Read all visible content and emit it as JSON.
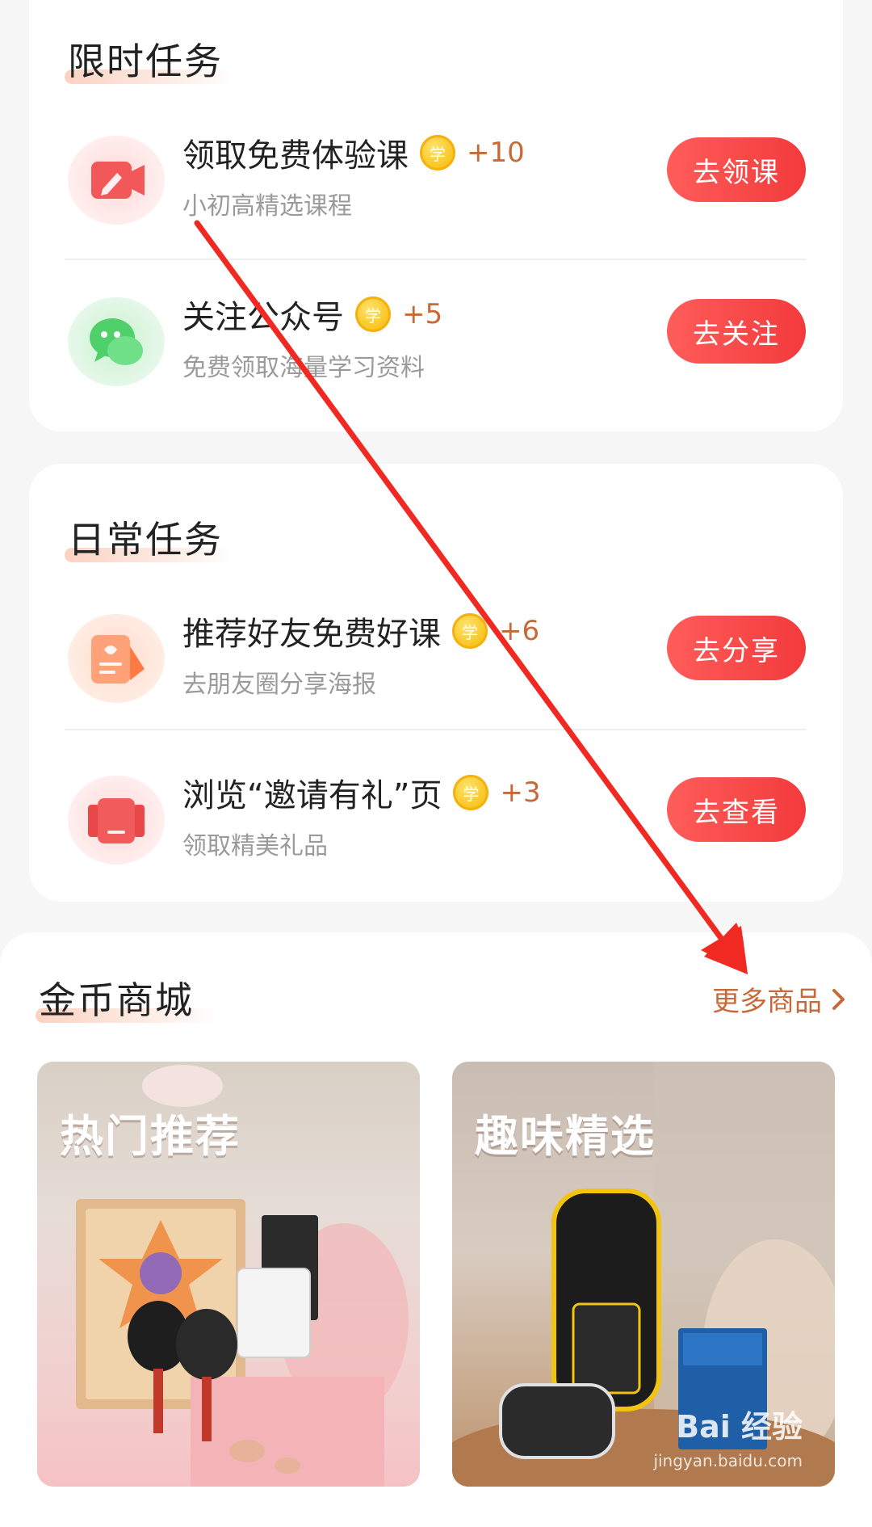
{
  "limited_tasks": {
    "title": "限时任务",
    "items": [
      {
        "title": "领取免费体验课",
        "reward": "+10",
        "subtitle": "小初高精选课程",
        "button": "去领课",
        "icon": "pencil-video-icon"
      },
      {
        "title": "关注公众号",
        "reward": "+5",
        "subtitle": "免费领取海量学习资料",
        "button": "去关注",
        "icon": "wechat-icon"
      }
    ]
  },
  "daily_tasks": {
    "title": "日常任务",
    "items": [
      {
        "title": "推荐好友免费好课",
        "reward": "+6",
        "subtitle": "去朋友圈分享海报",
        "button": "去分享",
        "icon": "share-poster-icon"
      },
      {
        "title": "浏览“邀请有礼”页",
        "reward": "+3",
        "subtitle": "领取精美礼品",
        "button": "去查看",
        "icon": "phone-gift-icon"
      }
    ]
  },
  "coin_label": "学",
  "mall": {
    "title": "金币商城",
    "more_link": "更多商品",
    "banners": [
      {
        "label": "热门推荐"
      },
      {
        "label": "趣味精选"
      }
    ]
  },
  "watermark": {
    "text": "Bai 经验",
    "sub": "jingyan.baidu.com"
  },
  "colors": {
    "accent": "#f23a3c",
    "reward": "#c8693a",
    "annotation_arrow": "#f02a22"
  }
}
